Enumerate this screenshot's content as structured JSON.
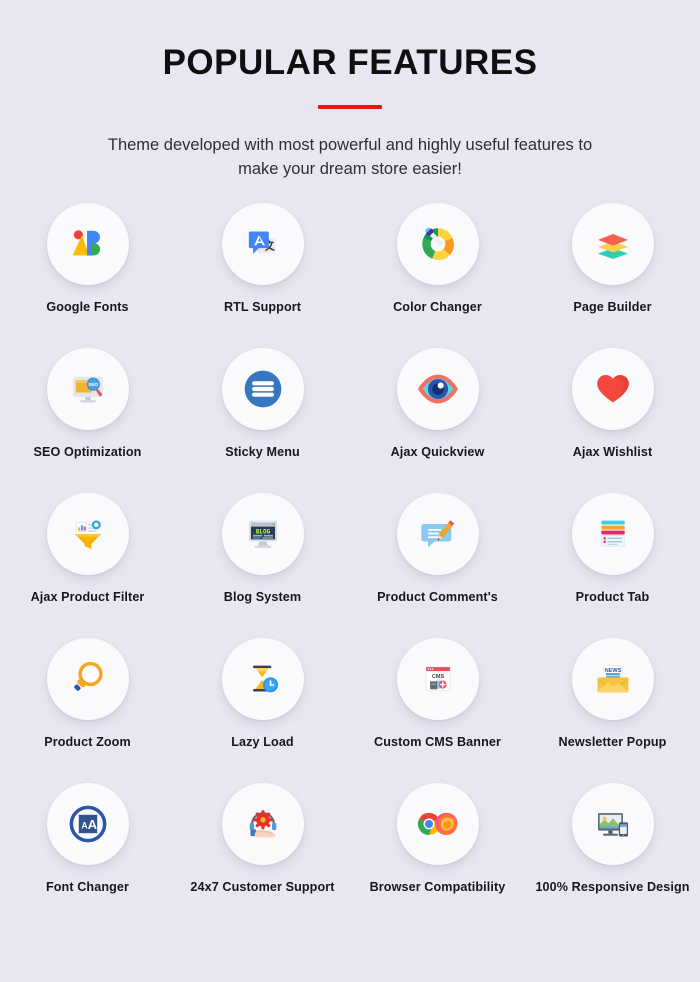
{
  "header": {
    "title": "POPULAR FEATURES",
    "subtitle": "Theme developed with most powerful and highly useful features to make your dream store easier!",
    "accent_color": "#fa0f0f",
    "background_color": "#e7e7f1",
    "title_color": "#0f0f10"
  },
  "features": [
    {
      "label": "Google Fonts",
      "icon": "google-fonts-icon"
    },
    {
      "label": "RTL Support",
      "icon": "translate-icon"
    },
    {
      "label": "Color Changer",
      "icon": "color-wheel-dropper-icon"
    },
    {
      "label": "Page Builder",
      "icon": "layers-icon"
    },
    {
      "label": "SEO Optimization",
      "icon": "seo-monitor-magnifier-icon"
    },
    {
      "label": "Sticky Menu",
      "icon": "hamburger-menu-icon"
    },
    {
      "label": "Ajax Quickview",
      "icon": "eye-icon"
    },
    {
      "label": "Ajax Wishlist",
      "icon": "heart-icon"
    },
    {
      "label": "Ajax Product Filter",
      "icon": "funnel-chart-icon"
    },
    {
      "label": "Blog System",
      "icon": "blog-monitor-icon"
    },
    {
      "label": "Product Comment's",
      "icon": "comment-pencil-icon"
    },
    {
      "label": "Product Tab",
      "icon": "tab-list-icon"
    },
    {
      "label": "Product Zoom",
      "icon": "magnifier-icon"
    },
    {
      "label": "Lazy Load",
      "icon": "hourglass-clock-icon"
    },
    {
      "label": "Custom CMS Banner",
      "icon": "cms-banner-icon"
    },
    {
      "label": "Newsletter Popup",
      "icon": "news-envelope-icon"
    },
    {
      "label": "Font Changer",
      "icon": "font-size-icon"
    },
    {
      "label": "24x7 Customer Support",
      "icon": "headset-gear-hand-icon"
    },
    {
      "label": "Browser Compatibility",
      "icon": "browsers-icon"
    },
    {
      "label": "100% Responsive Design",
      "icon": "responsive-devices-icon"
    }
  ]
}
